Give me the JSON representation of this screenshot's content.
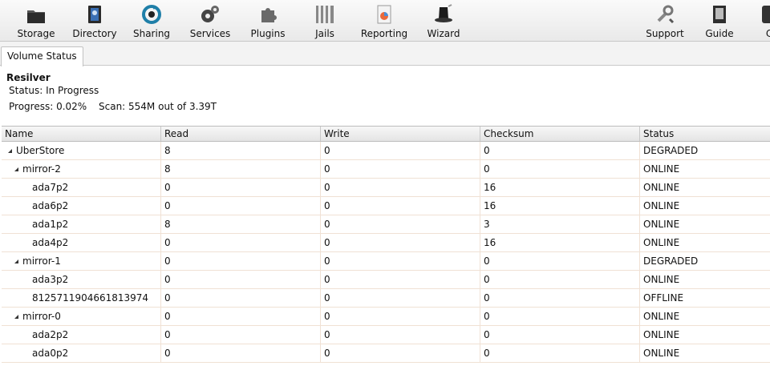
{
  "toolbar": {
    "items": [
      {
        "label": "Storage",
        "icon": "storage-icon"
      },
      {
        "label": "Directory",
        "icon": "directory-icon"
      },
      {
        "label": "Sharing",
        "icon": "sharing-icon"
      },
      {
        "label": "Services",
        "icon": "services-icon"
      },
      {
        "label": "Plugins",
        "icon": "plugins-icon"
      },
      {
        "label": "Jails",
        "icon": "jails-icon"
      },
      {
        "label": "Reporting",
        "icon": "reporting-icon"
      },
      {
        "label": "Wizard",
        "icon": "wizard-icon"
      },
      {
        "label": "Support",
        "icon": "support-icon"
      },
      {
        "label": "Guide",
        "icon": "guide-icon"
      },
      {
        "label": "C",
        "icon": "cut-off-icon"
      }
    ]
  },
  "tabs": [
    {
      "label": "Volume Status"
    }
  ],
  "resilver": {
    "title": "Resilver",
    "status": "Status: In Progress",
    "progress": "Progress: 0.02%",
    "scan": "Scan: 554M out of 3.39T"
  },
  "grid": {
    "columns": [
      "Name",
      "Read",
      "Write",
      "Checksum",
      "Status"
    ],
    "rows": [
      {
        "name": "UberStore",
        "read": "8",
        "write": "0",
        "checksum": "0",
        "status": "DEGRADED",
        "level": 0,
        "expandable": true
      },
      {
        "name": "mirror-2",
        "read": "8",
        "write": "0",
        "checksum": "0",
        "status": "ONLINE",
        "level": 1,
        "expandable": true
      },
      {
        "name": "ada7p2",
        "read": "0",
        "write": "0",
        "checksum": "16",
        "status": "ONLINE",
        "level": 2,
        "expandable": false
      },
      {
        "name": "ada6p2",
        "read": "0",
        "write": "0",
        "checksum": "16",
        "status": "ONLINE",
        "level": 2,
        "expandable": false
      },
      {
        "name": "ada1p2",
        "read": "8",
        "write": "0",
        "checksum": "3",
        "status": "ONLINE",
        "level": 2,
        "expandable": false
      },
      {
        "name": "ada4p2",
        "read": "0",
        "write": "0",
        "checksum": "16",
        "status": "ONLINE",
        "level": 2,
        "expandable": false
      },
      {
        "name": "mirror-1",
        "read": "0",
        "write": "0",
        "checksum": "0",
        "status": "DEGRADED",
        "level": 1,
        "expandable": true
      },
      {
        "name": "ada3p2",
        "read": "0",
        "write": "0",
        "checksum": "0",
        "status": "ONLINE",
        "level": 2,
        "expandable": false
      },
      {
        "name": "8125711904661813974",
        "read": "0",
        "write": "0",
        "checksum": "0",
        "status": "OFFLINE",
        "level": 2,
        "expandable": false
      },
      {
        "name": "mirror-0",
        "read": "0",
        "write": "0",
        "checksum": "0",
        "status": "ONLINE",
        "level": 1,
        "expandable": true
      },
      {
        "name": "ada2p2",
        "read": "0",
        "write": "0",
        "checksum": "0",
        "status": "ONLINE",
        "level": 2,
        "expandable": false
      },
      {
        "name": "ada0p2",
        "read": "0",
        "write": "0",
        "checksum": "0",
        "status": "ONLINE",
        "level": 2,
        "expandable": false
      }
    ]
  }
}
